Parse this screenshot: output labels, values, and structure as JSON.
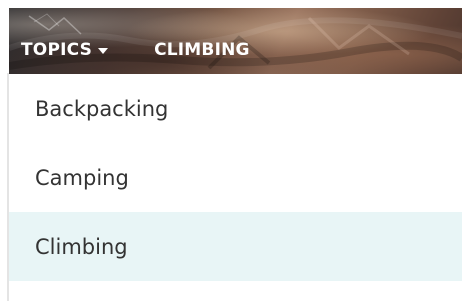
{
  "header": {
    "topics_label": "TOPICS",
    "topics_icon": "caret-down-icon",
    "current_topic": "CLIMBING"
  },
  "menu": {
    "items": [
      {
        "label": "Backpacking",
        "active": false
      },
      {
        "label": "Camping",
        "active": false
      },
      {
        "label": "Climbing",
        "active": true
      }
    ],
    "active_background": "#e8f5f6"
  }
}
